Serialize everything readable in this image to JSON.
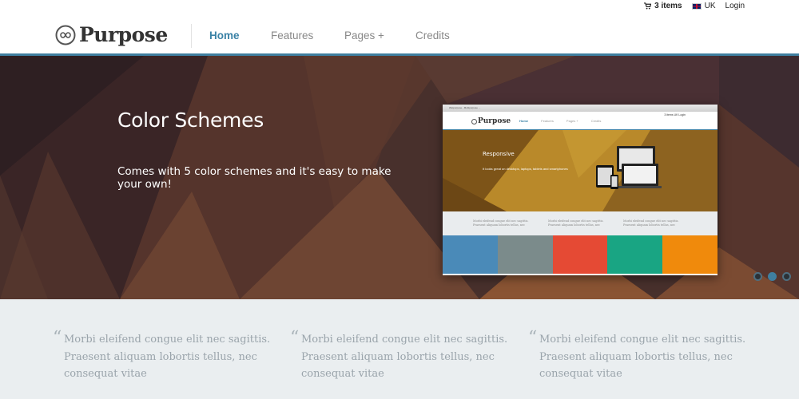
{
  "topbar": {
    "cart_label": "3 items",
    "language_label": "UK",
    "login_label": "Login"
  },
  "brand": {
    "name": "Purpose"
  },
  "nav": [
    {
      "label": "Home",
      "active": true
    },
    {
      "label": "Features",
      "active": false
    },
    {
      "label": "Pages +",
      "active": false
    },
    {
      "label": "Credits",
      "active": false
    }
  ],
  "hero": {
    "title": "Color Schemes",
    "description": "Comes with 5 color schemes and it's easy to make your own!",
    "slide_count": 3,
    "active_slide": 2
  },
  "preview": {
    "browser_tab": "Wetpurpose - Multipurpose ...",
    "topbar": "3 items  UK  Login",
    "brand": "Purpose",
    "nav": [
      "Home",
      "Features",
      "Pages +",
      "Credits"
    ],
    "hero_title": "Responsive",
    "hero_text": "It looks great on desktops, laptops, tablets and smartphones",
    "quotes": [
      "Morbi eleifend congue elit nec sagittis. Praesent aliquam lobortis tellus, nec",
      "Morbi eleifend congue elit nec sagittis. Praesent aliquam lobortis tellus, nec",
      "Morbi eleifend congue elit nec sagittis. Praesent aliquam lobortis tellus, nec"
    ],
    "swatches": [
      "#4a8ab8",
      "#7b8b8b",
      "#e54a34",
      "#19a583",
      "#f08a0c"
    ]
  },
  "quotes": [
    {
      "text": "Morbi eleifend congue elit nec sagittis. Praesent aliquam lobortis tellus, nec consequat vitae"
    },
    {
      "text": "Morbi eleifend congue elit nec sagittis. Praesent aliquam lobortis tellus, nec consequat vitae"
    },
    {
      "text": "Morbi eleifend congue elit nec sagittis. Praesent aliquam lobortis tellus, nec consequat vitae"
    }
  ],
  "colors": {
    "accent": "#3f7fa0",
    "hero_bg": "#4a2d2a",
    "quote_bg": "#eaeef0"
  }
}
